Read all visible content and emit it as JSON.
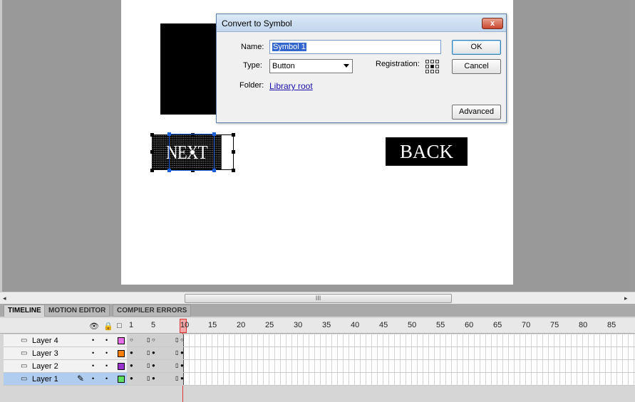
{
  "stage": {
    "next_label": "NEXT",
    "back_label": "BACK"
  },
  "scrollbar": {
    "left_arrow": "◂",
    "right_arrow": "▸",
    "grip": "III"
  },
  "panel": {
    "tabs": [
      {
        "label": "TIMELINE",
        "active": true
      },
      {
        "label": "MOTION EDITOR",
        "active": false
      },
      {
        "label": "COMPILER ERRORS",
        "active": false
      }
    ],
    "frame_numbers": [
      "1",
      "5",
      "10",
      "15",
      "20",
      "25",
      "30",
      "35",
      "40",
      "45",
      "50",
      "55",
      "60",
      "65",
      "70",
      "75",
      "80",
      "85"
    ],
    "current_frame": "10",
    "layers": [
      {
        "name": "Layer 4",
        "color": "#e86be8",
        "selected": false
      },
      {
        "name": "Layer 3",
        "color": "#ff8000",
        "selected": false
      },
      {
        "name": "Layer 2",
        "color": "#9a32cd",
        "selected": false
      },
      {
        "name": "Layer 1",
        "color": "#60e060",
        "selected": true
      }
    ],
    "icons": {
      "eye": "👁",
      "lock": "🔒",
      "outline": "□"
    }
  },
  "dialog": {
    "title": "Convert to Symbol",
    "close_label": "x",
    "name_label": "Name:",
    "name_value": "Symbol 1",
    "type_label": "Type:",
    "type_value": "Button",
    "registration_label": "Registration:",
    "folder_label": "Folder:",
    "folder_value": "Library root",
    "ok_label": "OK",
    "cancel_label": "Cancel",
    "advanced_label": "Advanced"
  }
}
